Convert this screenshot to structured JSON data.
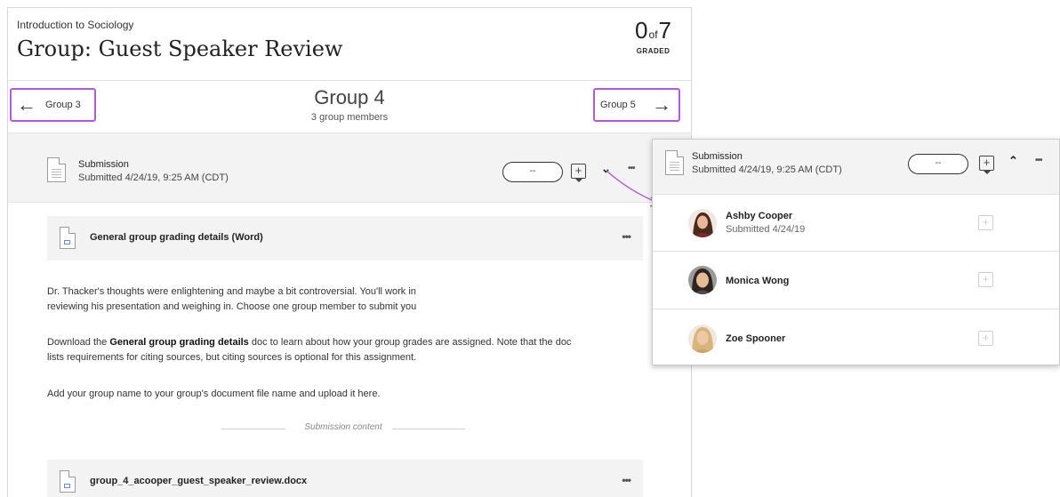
{
  "header": {
    "course_name": "Introduction to Sociology",
    "title": "Group: Guest Speaker Review",
    "graded": {
      "count": "0",
      "of": "of",
      "total": "7",
      "label": "GRADED"
    }
  },
  "group_nav": {
    "prev_label": "Group 3",
    "next_label": "Group 5",
    "current_group": "Group 4",
    "member_count": "3 group members"
  },
  "submission": {
    "title": "Submission",
    "date": "Submitted 4/24/19, 9:25 AM (CDT)",
    "grade": "--"
  },
  "attachments": [
    {
      "name": "General group grading details (Word)"
    },
    {
      "name": "group_4_acooper_guest_speaker_review.docx"
    }
  ],
  "instructions": {
    "p1_line1": "Dr. Thacker's thoughts were enlightening and maybe a bit controversial. You'll work in",
    "p1_line2": "reviewing his presentation and weighing in. Choose one group member to submit you",
    "p2_pre": "Download the ",
    "p2_bold": "General group grading details",
    "p2_post": " doc to learn about how your group grades are assigned. Note that the doc",
    "p2_line2": "lists requirements for citing sources, but citing sources is optional for this assignment.",
    "p3": "Add your group name to your group's document file name and upload it here."
  },
  "divider_label": "Submission content",
  "popup": {
    "title": "Submission",
    "date": "Submitted 4/24/19, 9:25 AM (CDT)",
    "grade": "--",
    "members": [
      {
        "name": "Ashby Cooper",
        "status": "Submitted 4/24/19"
      },
      {
        "name": "Monica Wong",
        "status": ""
      },
      {
        "name": "Zoe Spooner",
        "status": ""
      }
    ]
  },
  "icons": {
    "more": "•••",
    "chevron_down": "⌄",
    "chevron_up": "⌃",
    "add": "+",
    "arrow_left": "←",
    "arrow_right": "→"
  },
  "colors": {
    "highlight_border": "#b15bd6",
    "bar_bg": "#f3f3f3"
  }
}
